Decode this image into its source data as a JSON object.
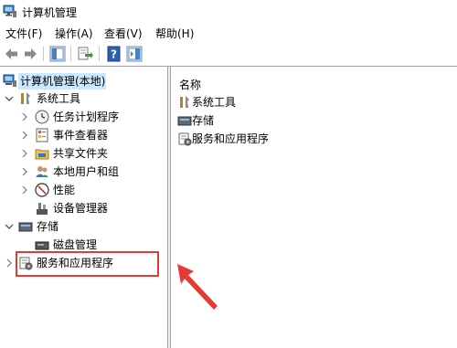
{
  "window": {
    "title": "计算机管理"
  },
  "menu": [
    {
      "label": "文件(F)"
    },
    {
      "label": "操作(A)"
    },
    {
      "label": "查看(V)"
    },
    {
      "label": "帮助(H)"
    }
  ],
  "toolbar": {
    "icons": [
      "back-arrow-icon",
      "forward-arrow-icon",
      "show-hide-console-tree-icon",
      "export-list-icon",
      "help-icon",
      "show-hide-action-pane-icon"
    ]
  },
  "tree": {
    "root": "计算机管理(本地)",
    "system_tools": "系统工具",
    "task_scheduler": "任务计划程序",
    "event_viewer": "事件查看器",
    "shared_folders": "共享文件夹",
    "local_users": "本地用户和组",
    "performance": "性能",
    "device_manager": "设备管理器",
    "storage": "存储",
    "disk_management": "磁盘管理",
    "services_apps": "服务和应用程序"
  },
  "list": {
    "column_name": "名称",
    "items": [
      "系统工具",
      "存储",
      "服务和应用程序"
    ]
  },
  "colors": {
    "selection": "#cce8ff",
    "highlight_box": "#e53935",
    "arrow": "#e53935"
  }
}
